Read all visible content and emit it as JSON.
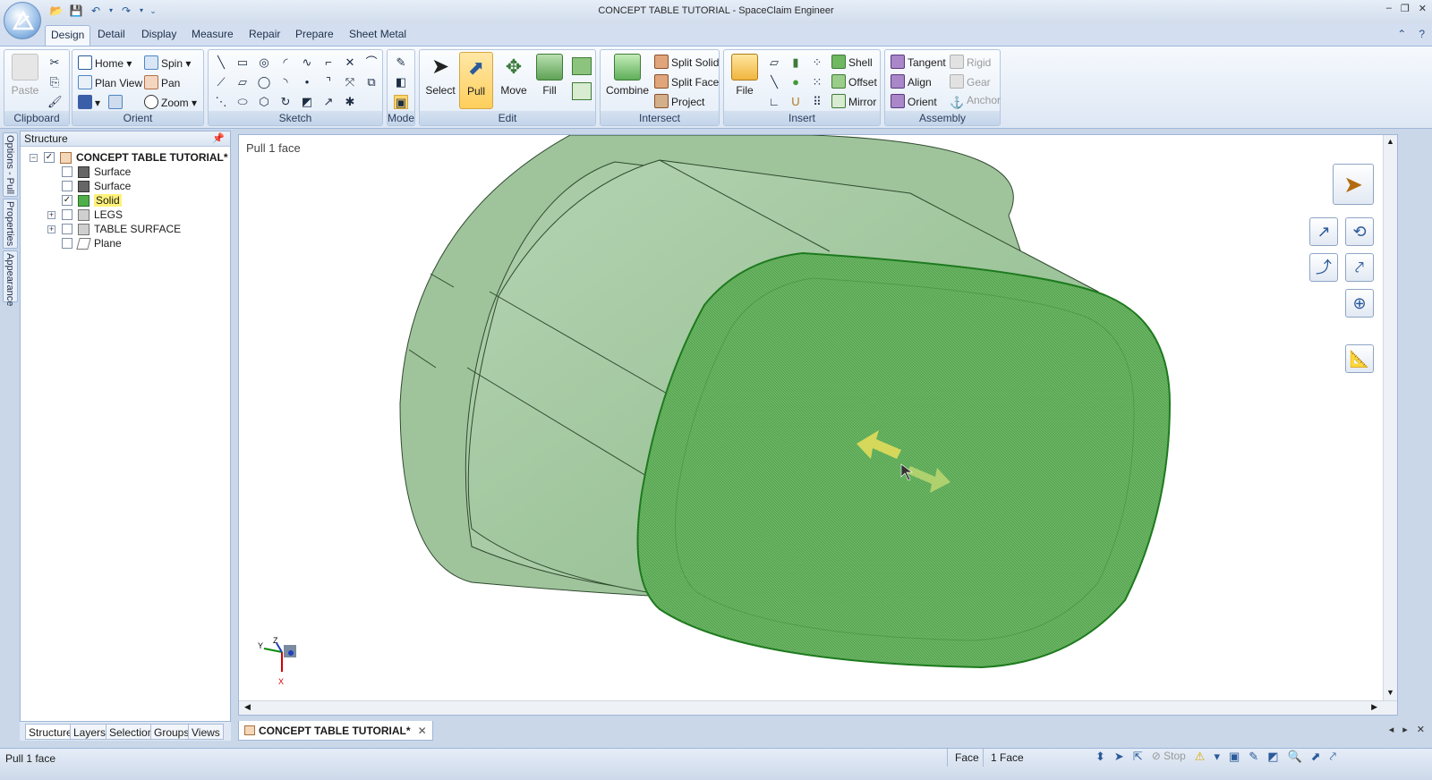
{
  "window": {
    "title": "CONCEPT TABLE TUTORIAL - SpaceClaim Engineer",
    "controls": [
      "–",
      "❐",
      "✕"
    ]
  },
  "tabs": [
    "Design",
    "Detail",
    "Display",
    "Measure",
    "Repair",
    "Prepare",
    "Sheet Metal"
  ],
  "active_tab": "Design",
  "ribbon": {
    "clipboard": {
      "label": "Clipboard",
      "paste": "Paste"
    },
    "orient": {
      "label": "Orient",
      "home": "Home",
      "spin": "Spin",
      "plan_view": "Plan View",
      "pan": "Pan",
      "zoom": "Zoom"
    },
    "sketch": {
      "label": "Sketch"
    },
    "mode": {
      "label": "Mode"
    },
    "edit": {
      "label": "Edit",
      "select": "Select",
      "pull": "Pull",
      "move": "Move",
      "fill": "Fill"
    },
    "intersect": {
      "label": "Intersect",
      "combine": "Combine",
      "split_solid": "Split Solid",
      "split_face": "Split Face",
      "project": "Project"
    },
    "insert": {
      "label": "Insert",
      "file": "File",
      "shell": "Shell",
      "offset": "Offset",
      "mirror": "Mirror"
    },
    "assembly": {
      "label": "Assembly",
      "tangent": "Tangent",
      "align": "Align",
      "orient": "Orient",
      "rigid": "Rigid",
      "gear": "Gear",
      "anchor": "Anchor"
    }
  },
  "side_tabs": [
    "Options - Pull",
    "Properties",
    "Appearance"
  ],
  "structure": {
    "title": "Structure",
    "root": "CONCEPT TABLE TUTORIAL*",
    "items": [
      {
        "label": "Surface",
        "checked": false
      },
      {
        "label": "Surface",
        "checked": false
      },
      {
        "label": "Solid",
        "checked": true
      },
      {
        "label": "LEGS",
        "checked": false
      },
      {
        "label": "TABLE SURFACE",
        "checked": false
      },
      {
        "label": "Plane",
        "checked": false
      }
    ],
    "tabs": [
      "Structure",
      "Layers",
      "Selection",
      "Groups",
      "Views"
    ]
  },
  "viewport": {
    "label": "Pull 1 face",
    "axis": {
      "x": "X",
      "y": "Y",
      "z": "Z"
    },
    "face_color": "#5fae5a",
    "body_color": "#a3c8a1"
  },
  "document_tab": "CONCEPT TABLE TUTORIAL*",
  "status": {
    "message": "Pull 1 face",
    "filter": "Face",
    "selection": "1 Face",
    "stop": "Stop"
  }
}
